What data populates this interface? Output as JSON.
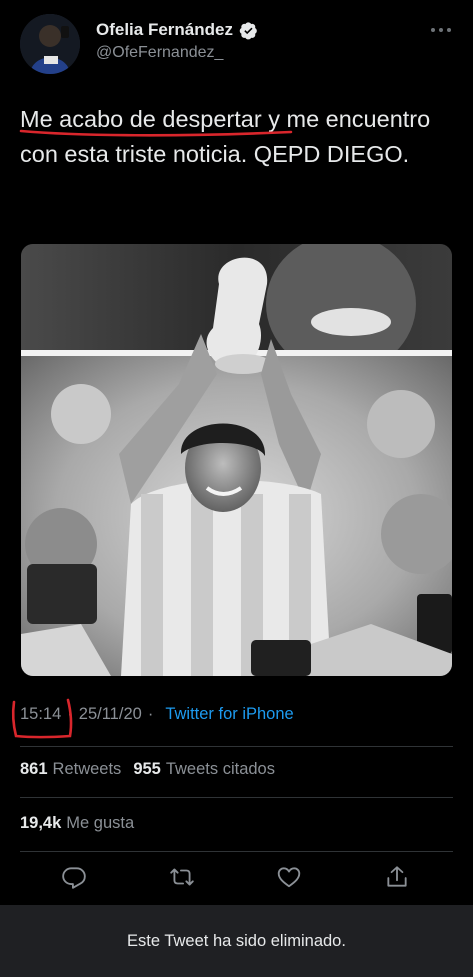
{
  "user": {
    "display_name": "Ofelia Fernández",
    "handle": "@OfeFernandez_",
    "verified": true,
    "avatar_icon": "avatar"
  },
  "header": {
    "more_icon": "more-horizontal-icon"
  },
  "tweet": {
    "text_highlighted": "Me acabo de despertar",
    "text_rest": " y me encuentro con esta triste noticia. QEPD DIEGO."
  },
  "meta": {
    "time": "15:14",
    "date": "25/11/20",
    "separator": "·",
    "source": "Twitter for iPhone"
  },
  "stats": {
    "retweets_count": "861",
    "retweets_label": "Retweets",
    "quotes_count": "955",
    "quotes_label": "Tweets citados",
    "likes_count": "19,4k",
    "likes_label": "Me gusta"
  },
  "actions": {
    "reply_icon": "reply-icon",
    "retweet_icon": "retweet-icon",
    "like_icon": "heart-icon",
    "share_icon": "share-icon"
  },
  "banner": {
    "text": "Este Tweet ha sido eliminado."
  },
  "colors": {
    "background": "#000000",
    "text": "#e7e9ea",
    "secondary": "#8b9096",
    "link": "#1d9bf0",
    "annotation_red": "#d9262c",
    "banner_bg": "#1f2023"
  }
}
